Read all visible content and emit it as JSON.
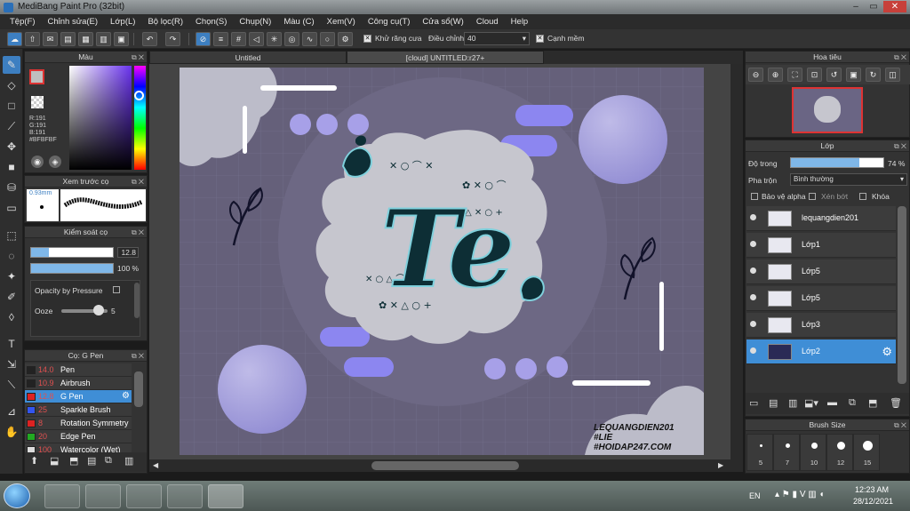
{
  "window": {
    "title": "MediBang Paint Pro (32bit)"
  },
  "menu": [
    "Tệp(F)",
    "Chỉnh sửa(E)",
    "Lớp(L)",
    "Bộ lọc(R)",
    "Chọn(S)",
    "Chụp(N)",
    "Màu (C)",
    "Xem(V)",
    "Công cụ(T)",
    "Cửa sổ(W)",
    "Cloud",
    "Help"
  ],
  "toolbar": {
    "antialias_label": "Khử răng cưa",
    "adjust_label": "Điều chỉnh",
    "adjust_value": "40",
    "edge_label": "Cạnh mềm"
  },
  "color_panel": {
    "title": "Màu",
    "r": "R:191",
    "g": "G:191",
    "b": "B:191",
    "hex": "#BFBFBF"
  },
  "brush_preview": {
    "title": "Xem trước cọ",
    "size": "0.93mm"
  },
  "brush_control": {
    "title": "Kiểm soát cọ",
    "size_value": "12.8",
    "opacity_value": "100 %",
    "opacity_pressure": "Opacity by Pressure",
    "ooze_label": "Ooze",
    "ooze_value": "5"
  },
  "brushes": {
    "title": "Cọ: G Pen",
    "items": [
      {
        "size": "14.0",
        "name": "Pen",
        "color": "#222222"
      },
      {
        "size": "10.9",
        "name": "Airbrush",
        "color": "#222222"
      },
      {
        "size": "12.8",
        "name": "G Pen",
        "color": "#dd2222"
      },
      {
        "size": "25",
        "name": "Sparkle Brush",
        "color": "#3355ee"
      },
      {
        "size": "8",
        "name": "Rotation Symmetry",
        "color": "#dd2222"
      },
      {
        "size": "20",
        "name": "Edge Pen",
        "color": "#22aa22"
      },
      {
        "size": "100",
        "name": "Watercolor (Wet)",
        "color": "#dddddd"
      }
    ]
  },
  "tabs": [
    {
      "label": "Untitled"
    },
    {
      "label": "[cloud] UNTITLED:r27+"
    }
  ],
  "canvas_art": {
    "big_letters": "Te",
    "sig1": "LEQUANGDIEN201",
    "sig2": "#LIE",
    "sig3": "#HOIDAP247.COM"
  },
  "navigator": {
    "title": "Hoa tiêu"
  },
  "layers": {
    "title": "Lớp",
    "opacity_label": "Độ trong",
    "opacity_value": "74 %",
    "opacity_fraction": 0.74,
    "blend_label": "Pha trộn",
    "blend_value": "Bình thường",
    "protect_alpha": "Bảo vệ alpha",
    "clip": "Xén bớt",
    "lock": "Khóa",
    "items": [
      {
        "name": "lequangdien201"
      },
      {
        "name": "Lớp1"
      },
      {
        "name": "Lớp5"
      },
      {
        "name": "Lớp5"
      },
      {
        "name": "Lớp3"
      },
      {
        "name": "Lớp2"
      }
    ]
  },
  "brush_size": {
    "title": "Brush Size",
    "sizes": [
      "5",
      "7",
      "10",
      "12",
      "15"
    ]
  },
  "taskbar": {
    "lang": "EN",
    "time": "12:23 AM",
    "date": "28/12/2021"
  }
}
